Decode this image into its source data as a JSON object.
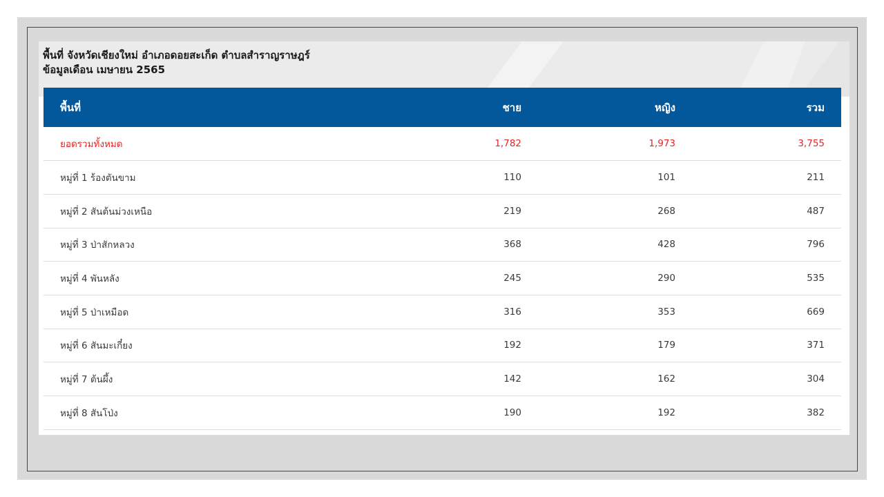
{
  "header": {
    "title": "พื้นที่ จังหวัดเชียงใหม่ อำเภอดอยสะเก็ด ตำบลสำราญราษฎร์",
    "subtitle": "ข้อมูลเดือน เมษายน 2565"
  },
  "table": {
    "columns": {
      "area": "พื้นที่",
      "male": "ชาย",
      "female": "หญิง",
      "total": "รวม"
    },
    "rows": [
      {
        "area": "ยอดรวมทั้งหมด",
        "male": "1,782",
        "female": "1,973",
        "total": "3,755"
      },
      {
        "area": "หมู่ที่ 1 ร้องตันขาม",
        "male": "110",
        "female": "101",
        "total": "211"
      },
      {
        "area": "หมู่ที่ 2 สันต้นม่วงเหนือ",
        "male": "219",
        "female": "268",
        "total": "487"
      },
      {
        "area": "หมู่ที่ 3 ป่าสักหลวง",
        "male": "368",
        "female": "428",
        "total": "796"
      },
      {
        "area": "หมู่ที่ 4 พันหลัง",
        "male": "245",
        "female": "290",
        "total": "535"
      },
      {
        "area": "หมู่ที่ 5 ป่าเหมือด",
        "male": "316",
        "female": "353",
        "total": "669"
      },
      {
        "area": "หมู่ที่ 6 สันมะเกี๋ยง",
        "male": "192",
        "female": "179",
        "total": "371"
      },
      {
        "area": "หมู่ที่ 7 ต้นผึ้ง",
        "male": "142",
        "female": "162",
        "total": "304"
      },
      {
        "area": "หมู่ที่ 8 สันโป่ง",
        "male": "190",
        "female": "192",
        "total": "382"
      }
    ]
  },
  "colors": {
    "header_bg": "#03579b",
    "total_text": "#e32526",
    "body_text": "#3a3a3a"
  }
}
